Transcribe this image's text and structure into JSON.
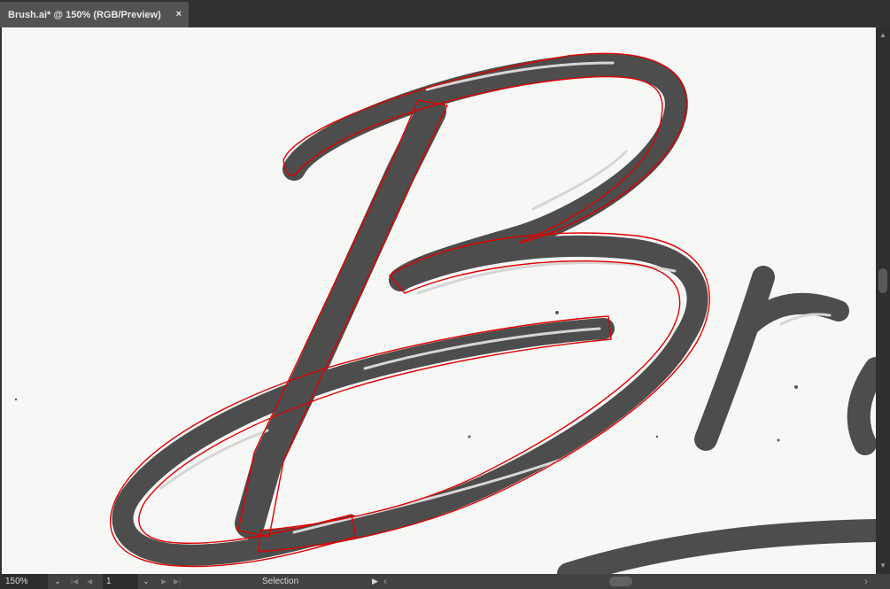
{
  "document_tab": {
    "title": "Brush.ai* @ 150% (RGB/Preview)",
    "close_glyph": "×"
  },
  "status_bar": {
    "zoom": "150%",
    "dropdown_glyph": "⌄",
    "first_glyph": "|◀",
    "prev_glyph": "◀",
    "page": "1",
    "next_glyph": "▶",
    "last_glyph": "▶|",
    "tool": "Selection",
    "play_glyph": "▶",
    "scroll_left_glyph": "‹",
    "scroll_right_glyph": "›"
  },
  "scrollbar": {
    "up_glyph": "▲",
    "down_glyph": "▼"
  },
  "colors": {
    "selection_outline": "#e00000",
    "ink": "#4a4a4a",
    "artboard": "#f7f7f6",
    "chrome": "#323232"
  },
  "icons": [
    "close-icon",
    "chevron-down-icon",
    "first-page-icon",
    "previous-page-icon",
    "next-page-icon",
    "last-page-icon",
    "play-icon"
  ]
}
